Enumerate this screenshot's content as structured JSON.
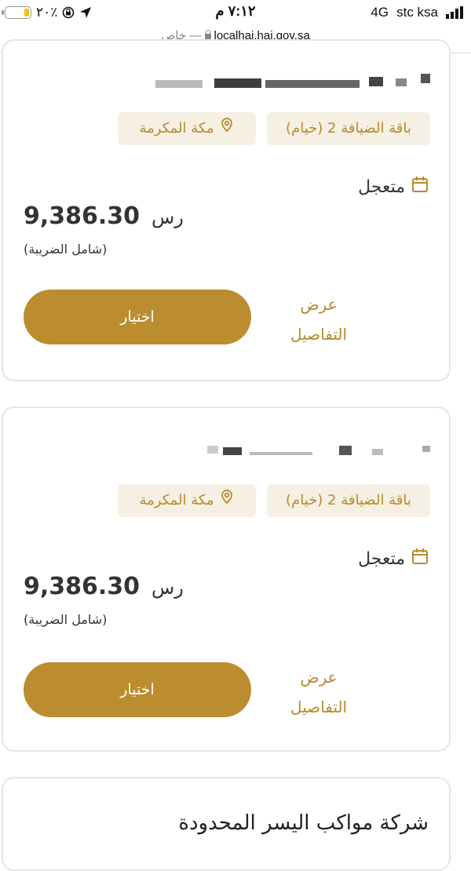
{
  "status_bar": {
    "battery_percent": "٢٠٪",
    "time": "٧:١٢ م",
    "network": "4G",
    "carrier": "stc ksa"
  },
  "url_bar": {
    "url": "localhaj.haj.gov.sa",
    "private_label": "خاص —"
  },
  "packages": [
    {
      "package_type": "باقة الضيافة 2 (خيام)",
      "location": "مكة المكرمة",
      "status": "متعجل",
      "price_amount": "9,386.30",
      "currency": "رس",
      "tax_note": "(شامل الضريبة)",
      "choose_label": "اختيار",
      "details_label_line1": "عرض",
      "details_label_line2": "التفاصيل"
    },
    {
      "package_type": "باقة الضيافة 2 (خيام)",
      "location": "مكة المكرمة",
      "status": "متعجل",
      "price_amount": "9,386.30",
      "currency": "رس",
      "tax_note": "(شامل الضريبة)",
      "choose_label": "اختيار",
      "details_label_line1": "عرض",
      "details_label_line2": "التفاصيل"
    }
  ],
  "third_card": {
    "company_name": "شركة مواكب اليسر المحدودة"
  },
  "colors": {
    "accent": "#bb8d2f",
    "pill_bg": "#f6f0e4",
    "pill_text": "#b58b2b"
  },
  "icons": {
    "location": "location-pin-icon",
    "status": "calendar-icon"
  }
}
